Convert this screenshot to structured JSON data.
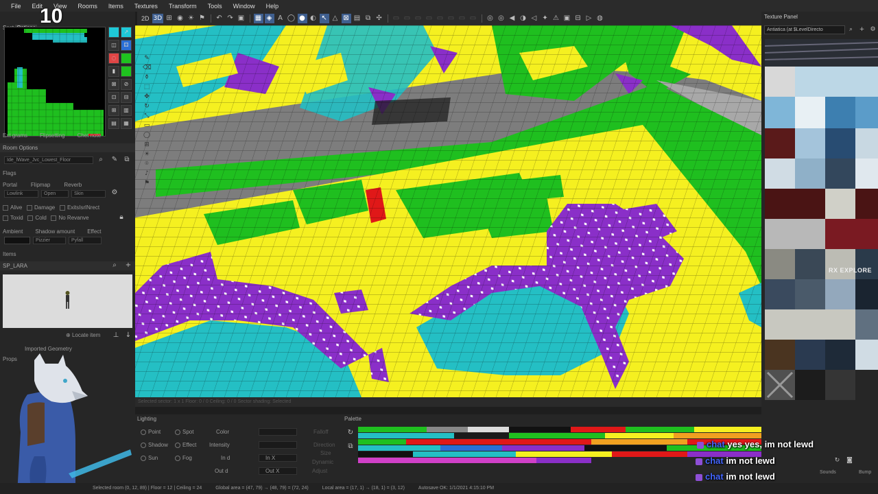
{
  "menu": [
    "File",
    "Edit",
    "View",
    "Rooms",
    "Items",
    "Textures",
    "Transform",
    "Tools",
    "Window",
    "Help"
  ],
  "overlay": {
    "counter": "10"
  },
  "left": {
    "section_label": "Sect",
    "section_btn": "Options",
    "room_options_title": "Room Options",
    "room_select": "Ide_lWave_Jvc_Lowest_Floor",
    "tabs": [
      "Ext grams",
      "Flipsetting",
      "Chet note"
    ],
    "flags_label": "Flags",
    "row1": [
      "Portal",
      "Flipmap",
      "Reverb"
    ],
    "row1_vals": [
      "Lowlink",
      "Open",
      "Skin"
    ],
    "checks": [
      "Alive",
      "Damage",
      "ExitsIsrlNrect"
    ],
    "checks2": [
      "Toxid",
      "Cold",
      "No Revanve"
    ],
    "ambient_label": "Ambient",
    "effects": [
      "Shadow amount",
      "Effect"
    ],
    "effects_vals": [
      "Pizzier",
      "Pyfall"
    ],
    "objects_label": "Items",
    "item_name": "SP_LARA",
    "locate_btn": "Locate item",
    "imported_label": "Imported Geometry",
    "props_label": "Props"
  },
  "toolbar": [
    "2D",
    "3D"
  ],
  "side_icons": [
    "pen",
    "eraser",
    "bucket",
    "select",
    "move",
    "rotate",
    "scale",
    "rect",
    "circle",
    "grid",
    "light",
    "camera",
    "sound",
    "flag",
    "ghost"
  ],
  "status_hint": "Selected sector: 1 x 1 Floor: 0 / 0 Ceiling: 0 / 0 Sector shading: Selected",
  "lighting": {
    "title": "Lighting",
    "buttons": [
      "Point",
      "Spot",
      "Shadow",
      "Effect",
      "Sun",
      "Fog"
    ],
    "labels": [
      "Color",
      "Intensity",
      "In d",
      "Out d",
      "In X",
      "Out X"
    ],
    "right": [
      "Falloff",
      "Direction",
      "Size",
      "Dynamic",
      "Adjust"
    ]
  },
  "palette": {
    "title": "Palette"
  },
  "texture_panel": {
    "title": "Texture Panel",
    "select": "Antiatica (at $LevelDirecto",
    "label_explore": "RX EXPLORE",
    "sounds_label": "Sounds",
    "bump_label": "Bump"
  },
  "chat": [
    {
      "user": "chat",
      "text": "yes yes, im not lewd"
    },
    {
      "user": "chat",
      "text": "im not lewd"
    },
    {
      "user": "chat",
      "text": "im not lewd"
    }
  ],
  "statusbar": [
    "Selected room (0, 12, 89) | Floor = 12 | Ceiling = 24",
    "Global area = (47, 79) → (48, 79) = (72, 24)",
    "Local area = (17, 1) → (18, 1) = (3, 12)",
    "Autosave OK: 1/1/2021 4:15:10 PM"
  ],
  "colors": {
    "green": "#1fbf1f",
    "yellow": "#f5f020",
    "purple": "#8a2fc8",
    "cyan": "#24bfc4",
    "red": "#e01818",
    "accent": "#3f5f8f"
  }
}
